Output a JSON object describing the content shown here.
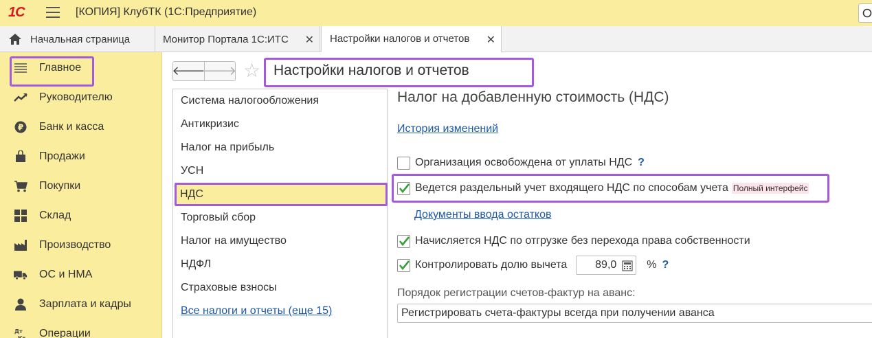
{
  "app": {
    "logo_text": "1С",
    "window_title": "[КОПИЯ] КлубТК  (1С:Предприятие)"
  },
  "tabs": [
    {
      "label": "Начальная страница",
      "icon": "home-icon"
    },
    {
      "label": "Монитор Портала 1С:ИТС",
      "close": "✕"
    },
    {
      "label": "Настройки налогов и отчетов",
      "close": "✕",
      "active": true
    }
  ],
  "sidebar": {
    "items": [
      {
        "label": "Главное",
        "icon": "list-lines-icon"
      },
      {
        "label": "Руководителю",
        "icon": "trend-up-icon"
      },
      {
        "label": "Банк и касса",
        "icon": "ruble-coin-icon"
      },
      {
        "label": "Продажи",
        "icon": "shopping-bag-icon"
      },
      {
        "label": "Покупки",
        "icon": "cart-icon"
      },
      {
        "label": "Склад",
        "icon": "warehouse-grid-icon"
      },
      {
        "label": "Производство",
        "icon": "factory-icon"
      },
      {
        "label": "ОС и НМА",
        "icon": "truck-icon"
      },
      {
        "label": "Зарплата и кадры",
        "icon": "person-icon"
      },
      {
        "label": "Операции",
        "icon": "dt-kt-icon"
      }
    ]
  },
  "header": {
    "back_glyph": "🡐",
    "forward_glyph": "🡒",
    "star_glyph": "☆",
    "page_title": "Настройки налогов и отчетов"
  },
  "left_list": {
    "items": [
      "Система налогообложения",
      "Антикризис",
      "Налог на прибыль",
      "УСН",
      "НДС",
      "Торговый сбор",
      "Налог на имущество",
      "НДФЛ",
      "Страховые взносы"
    ],
    "selected": "НДС",
    "more_link": "Все налоги и отчеты (еще 15)"
  },
  "main": {
    "section_title": "Налог на добавленную стоимость (НДС)",
    "history_link": "История изменений",
    "exempt_label": "Организация освобождена от уплаты НДС",
    "exempt_checked": false,
    "help_mark": "?",
    "separate_label": "Ведется раздельный учет входящего НДС по способам учета",
    "separate_checked": true,
    "separate_badge": "Полный интерфейс",
    "opening_docs_link": "Документы ввода остатков",
    "shipment_label": "Начисляется НДС по отгрузке без перехода права собственности",
    "shipment_checked": true,
    "deduction_label": "Контролировать долю вычета",
    "deduction_checked": true,
    "deduction_value": "89,0",
    "percent_sign": "%",
    "invoice_order_label": "Порядок регистрации счетов-фактур на аванс:",
    "invoice_order_value": "Регистрировать счета-фактуры всегда при получении аванса"
  },
  "colors": {
    "accent_yellow": "#fbed9e",
    "highlight_purple": "#a35bdc",
    "link_blue": "#1c5aa6",
    "check_green": "#3a9e3a",
    "logo_red": "#d71a21"
  }
}
